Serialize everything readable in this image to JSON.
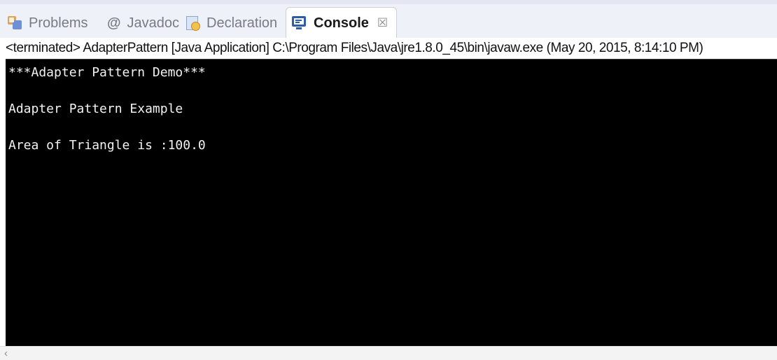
{
  "tabs": [
    {
      "label": "Problems",
      "icon": "problems-icon",
      "active": false
    },
    {
      "label": "Javadoc",
      "icon": "javadoc-icon",
      "active": false
    },
    {
      "label": "Declaration",
      "icon": "declaration-icon",
      "active": false
    },
    {
      "label": "Console",
      "icon": "console-icon",
      "active": true
    }
  ],
  "javadoc_glyph": "@",
  "console_close_glyph": "☒",
  "status_line": "<terminated> AdapterPattern [Java Application] C:\\Program Files\\Java\\jre1.8.0_45\\bin\\javaw.exe (May 20, 2015, 8:14:10 PM)",
  "console_lines": [
    "***Adapter Pattern Demo***",
    "",
    "Adapter Pattern Example",
    "",
    "Area of Triangle is :100.0"
  ],
  "scroll_left_glyph": "‹",
  "colors": {
    "console_bg": "#000000",
    "console_text": "#f2f2f2",
    "tabbar_bg": "#eef1f7",
    "accent": "#2f5ea8"
  }
}
